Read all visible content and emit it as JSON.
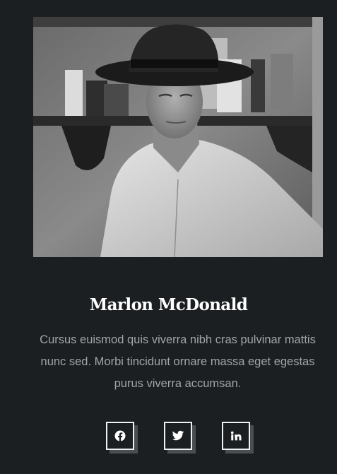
{
  "profile": {
    "name": "Marlon McDonald",
    "bio": "Cursus euismod quis viverra nibh cras pulvinar mattis nunc sed. Morbi tincidunt ornare massa eget egestas purus viverra accumsan.",
    "photo_alt": "Marlon McDonald"
  },
  "socials": [
    {
      "icon": "facebook-icon"
    },
    {
      "icon": "twitter-icon"
    },
    {
      "icon": "linkedin-icon"
    }
  ],
  "colors": {
    "background": "#1c1f21",
    "name": "#ffffff",
    "bio": "#a2a5a8",
    "icon_border": "#eef0f1",
    "icon_shadow": "#4a4d51"
  }
}
